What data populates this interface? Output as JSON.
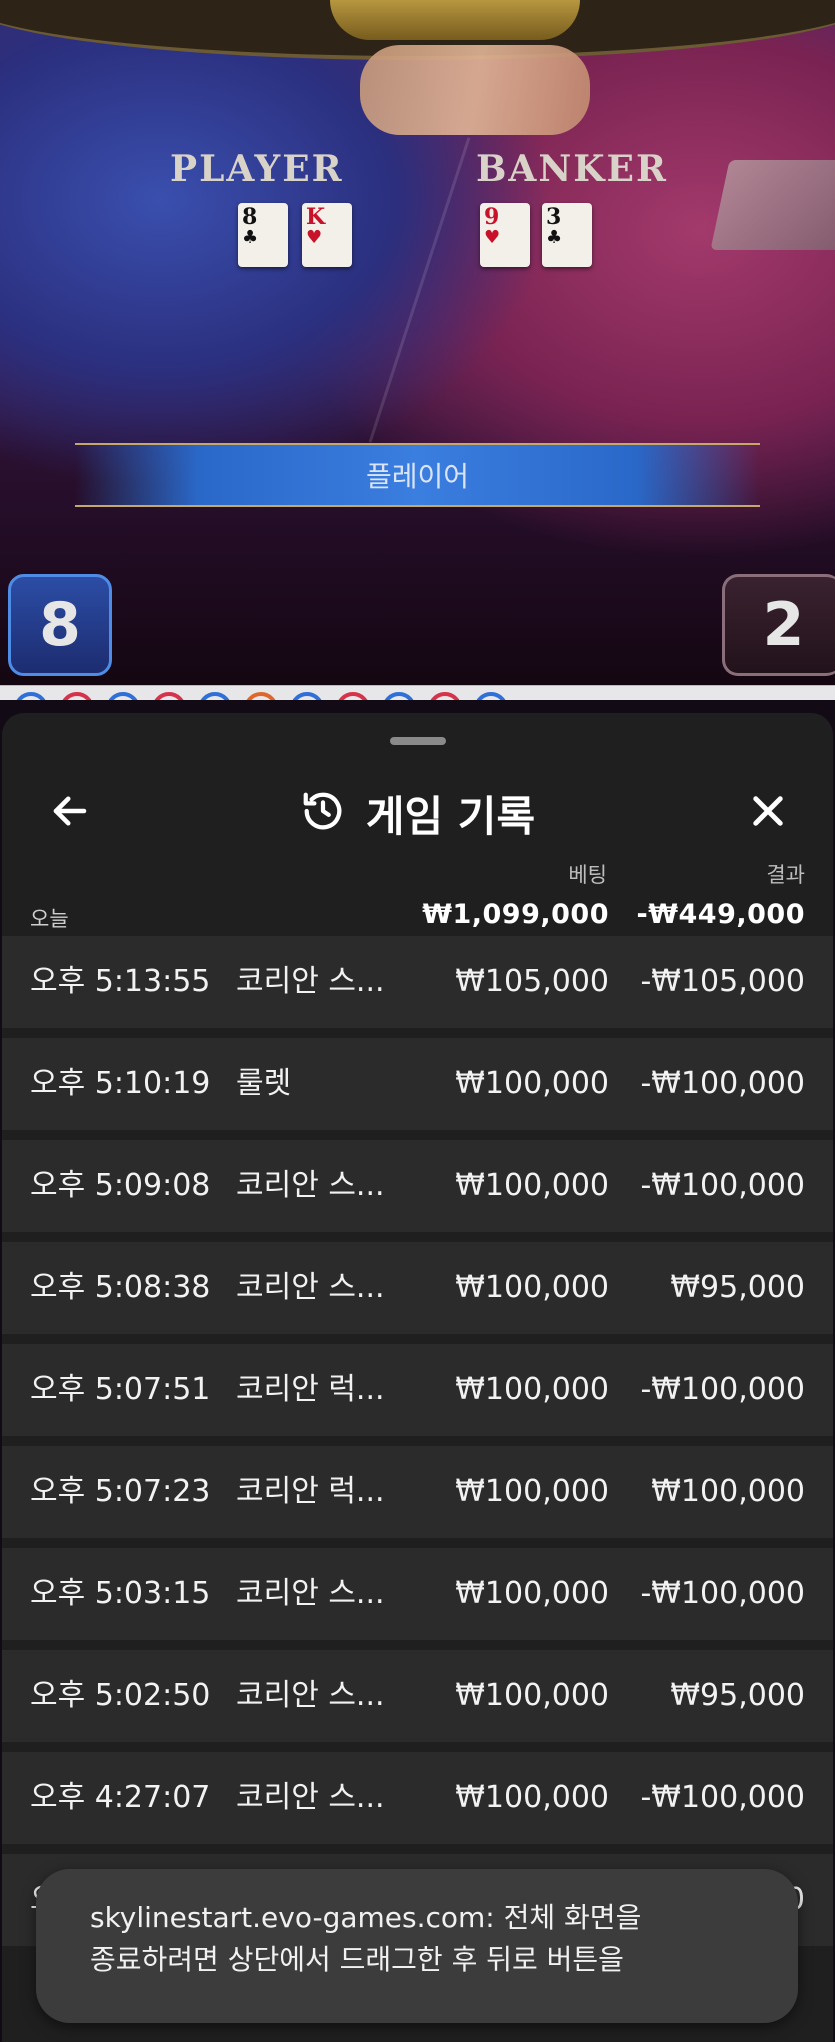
{
  "game": {
    "player_label": "PLAYER",
    "banker_label": "BANKER",
    "player_cards": [
      {
        "rank": "8",
        "suit": "♣",
        "color": "black"
      },
      {
        "rank": "K",
        "suit": "♥",
        "color": "red"
      }
    ],
    "banker_cards": [
      {
        "rank": "9",
        "suit": "♥",
        "color": "red"
      },
      {
        "rank": "3",
        "suit": "♣",
        "color": "black"
      }
    ],
    "result_banner": "플레이어",
    "player_score": "8",
    "banker_score": "2",
    "road_colors": [
      "#2f6fd8",
      "#d6324a",
      "#2f6fd8",
      "#d6324a",
      "#2f6fd8",
      "#e0672a",
      "#2f6fd8",
      "#d6324a",
      "#2f6fd8",
      "#d6324a",
      "#2f6fd8"
    ]
  },
  "sheet": {
    "title": "게임 기록",
    "title_icon": "history-icon",
    "back_icon": "arrow-left-icon",
    "close_icon": "close-icon",
    "columns": {
      "bet": "베팅",
      "result": "결과"
    },
    "summary": {
      "label": "오늘",
      "bet_total": "₩1,099,000",
      "result_total": "-₩449,000"
    },
    "rows": [
      {
        "time": "오후 5:13:55",
        "game": "코리안 스...",
        "bet": "₩105,000",
        "result": "-₩105,000"
      },
      {
        "time": "오후 5:10:19",
        "game": "룰렛",
        "bet": "₩100,000",
        "result": "-₩100,000"
      },
      {
        "time": "오후 5:09:08",
        "game": "코리안 스...",
        "bet": "₩100,000",
        "result": "-₩100,000"
      },
      {
        "time": "오후 5:08:38",
        "game": "코리안 스...",
        "bet": "₩100,000",
        "result": "₩95,000"
      },
      {
        "time": "오후 5:07:51",
        "game": "코리안 럭...",
        "bet": "₩100,000",
        "result": "-₩100,000"
      },
      {
        "time": "오후 5:07:23",
        "game": "코리안 럭...",
        "bet": "₩100,000",
        "result": "₩100,000"
      },
      {
        "time": "오후 5:03:15",
        "game": "코리안 스...",
        "bet": "₩100,000",
        "result": "-₩100,000"
      },
      {
        "time": "오후 5:02:50",
        "game": "코리안 스...",
        "bet": "₩100,000",
        "result": "₩95,000"
      },
      {
        "time": "오후 4:27:07",
        "game": "코리안 스...",
        "bet": "₩100,000",
        "result": "-₩100,000"
      },
      {
        "time": "오후 4:26:",
        "game": "",
        "bet": "",
        "result": "0"
      }
    ]
  },
  "toast": {
    "line1": "skylinestart.evo-games.com: 전체 화면을",
    "line2": "종료하려면 상단에서 드래그한 후 뒤로 버튼을"
  }
}
